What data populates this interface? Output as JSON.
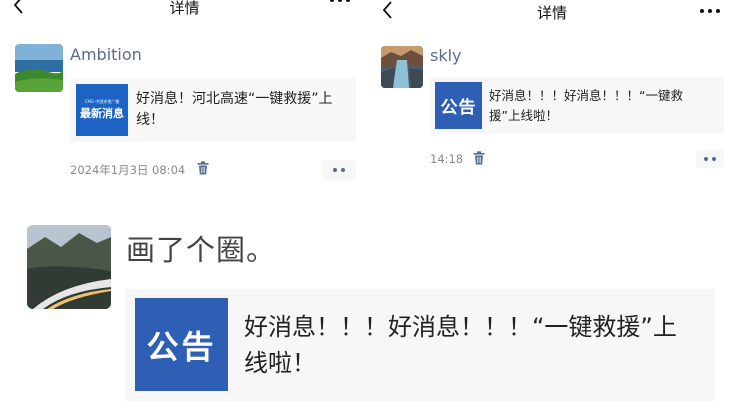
{
  "left_post": {
    "title": "详情",
    "username": "Ambition",
    "share_thumb_top": "CMG 中国央视广播",
    "share_thumb_main": "最新消息",
    "share_text": "好消息！河北高速“一键救援”上线！",
    "timestamp": "2024年1月3日 08:04"
  },
  "right_post": {
    "title": "详情",
    "username": "skly",
    "share_thumb_label": "公告",
    "share_text": "好消息！！！好消息！！！“一键救援”上线啦！",
    "timestamp": "14:18"
  },
  "zoom_post": {
    "caption": "画了个圈。",
    "share_thumb_label": "公告",
    "share_text": "好消息！！！好消息！！！“一键救援”上线啦！"
  },
  "colors": {
    "link_blue": "#576b95",
    "notice_blue": "#2f5fb4",
    "card_bg": "#f7f7f7"
  },
  "icons": [
    "back-icon",
    "more-icon",
    "trash-icon",
    "dots-icon"
  ]
}
